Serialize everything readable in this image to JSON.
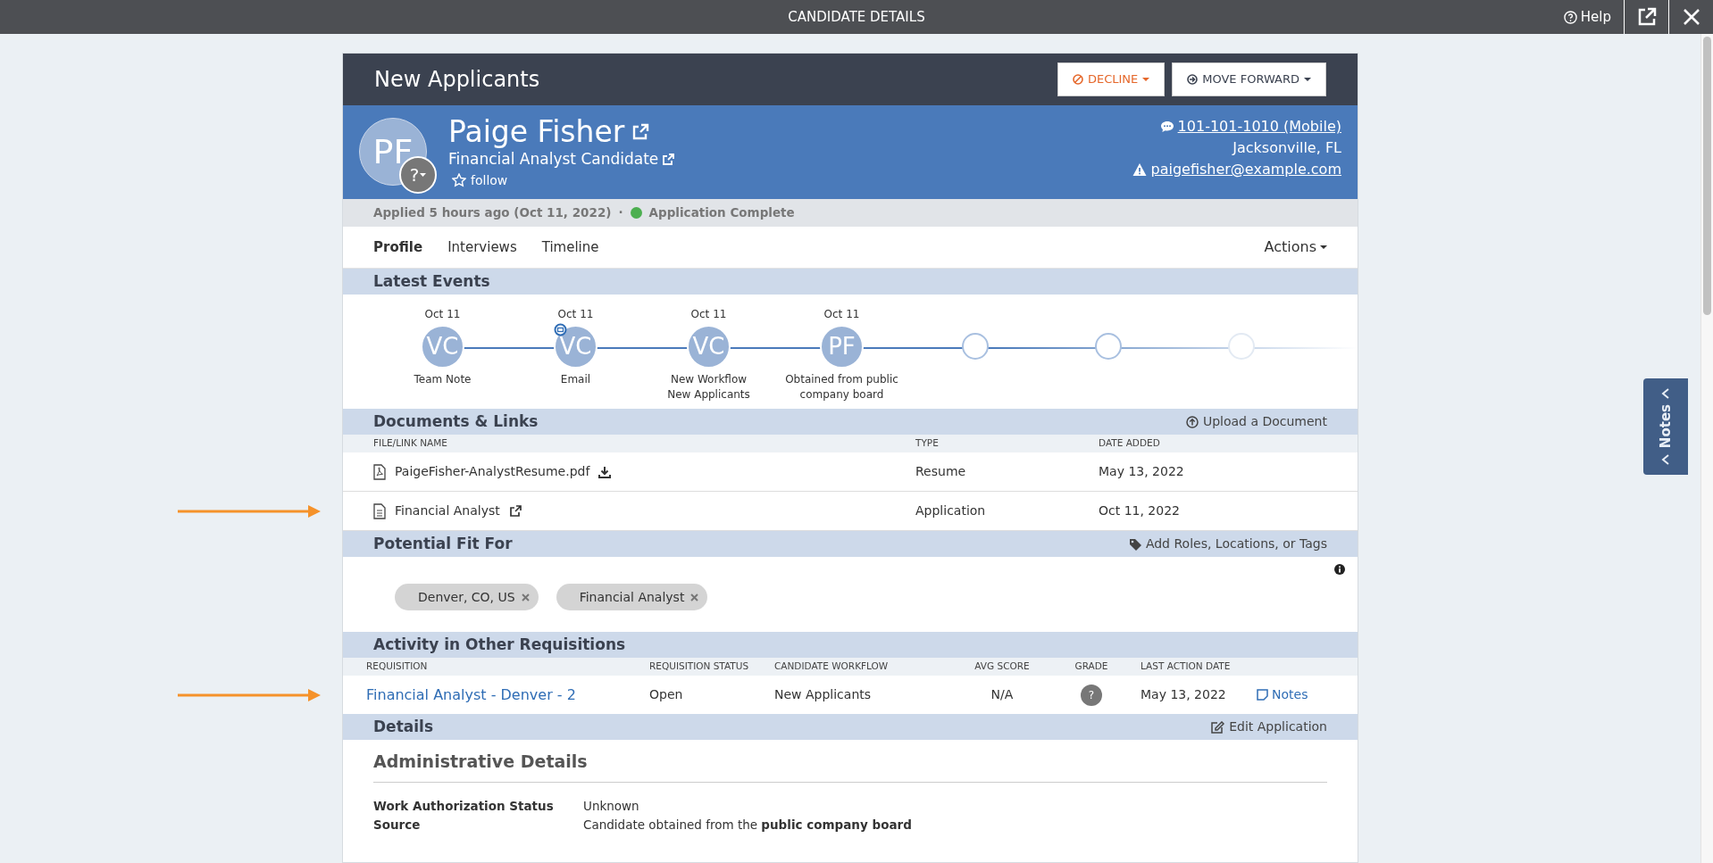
{
  "top_bar": {
    "title": "CANDIDATE DETAILS",
    "help": "Help"
  },
  "header": {
    "stage": "New Applicants",
    "buttons": [
      {
        "label": "DECLINE",
        "kind": "decline"
      },
      {
        "label": "MOVE FORWARD",
        "kind": "forward"
      }
    ]
  },
  "candidate": {
    "initials": "PF",
    "grade_badge": "?",
    "name": "Paige Fisher",
    "headline": "Financial Analyst Candidate",
    "follow": "follow",
    "phone": "101-101-1010 (Mobile)",
    "location": "Jacksonville, FL",
    "email": "paigefisher@example.com",
    "email_warning": true
  },
  "status_bar": {
    "applied": "Applied 5 hours ago (Oct 11, 2022)",
    "separator": "·",
    "status": "Application Complete",
    "color": "#4caf50"
  },
  "tabs": [
    {
      "label": "Profile",
      "selected": true
    },
    {
      "label": "Interviews",
      "selected": false
    },
    {
      "label": "Timeline",
      "selected": false
    }
  ],
  "actions": "Actions",
  "latest_events": {
    "title": "Latest Events",
    "events": [
      {
        "kind": "event",
        "date": "Oct 11",
        "initials": "VC",
        "label": "Team Note",
        "indicator": false
      },
      {
        "kind": "event",
        "date": "Oct 11",
        "initials": "VC",
        "label": "Email",
        "indicator": true
      },
      {
        "kind": "event",
        "date": "Oct 11",
        "initials": "VC",
        "label": "New Workflow\nNew Applicants",
        "indicator": false
      },
      {
        "kind": "event",
        "date": "Oct 11",
        "initials": "PF",
        "label": "Obtained from public\ncompany board",
        "indicator": false
      },
      {
        "kind": "empty"
      },
      {
        "kind": "empty"
      },
      {
        "kind": "empty"
      }
    ]
  },
  "documents": {
    "title": "Documents & Links",
    "action": "Upload a Document",
    "columns": [
      "FILE/LINK NAME",
      "TYPE",
      "DATE ADDED"
    ],
    "rows": [
      {
        "kind": "file",
        "name": "PaigeFisher-AnalystResume.pdf",
        "type": "Resume",
        "date": "May 13, 2022",
        "annotated": false
      },
      {
        "kind": "link",
        "name": "Financial Analyst",
        "type": "Application",
        "date": "Oct 11, 2022",
        "annotated": true
      }
    ]
  },
  "potential_fit": {
    "title": "Potential Fit For",
    "action": "Add Roles, Locations, or Tags",
    "tags": [
      "Denver, CO, US",
      "Financial Analyst"
    ]
  },
  "activity": {
    "title": "Activity in Other Requisitions",
    "columns": [
      "REQUISITION",
      "REQUISITION STATUS",
      "CANDIDATE WORKFLOW",
      "AVG SCORE",
      "GRADE",
      "LAST ACTION DATE"
    ],
    "rows": [
      {
        "requisition": "Financial Analyst - Denver - 2",
        "status": "Open",
        "workflow": "New Applicants",
        "avg_score": "N/A",
        "grade": "?",
        "last_action": "May 13, 2022",
        "notes": "Notes",
        "annotated": true
      }
    ]
  },
  "details": {
    "title": "Details",
    "action": "Edit Application",
    "section": "Administrative Details",
    "fields": [
      {
        "label": "Work Authorization Status",
        "value": "Unknown"
      },
      {
        "label": "Source",
        "value": "Candidate obtained from the **public company board**"
      }
    ]
  },
  "notes_tab": "Notes"
}
